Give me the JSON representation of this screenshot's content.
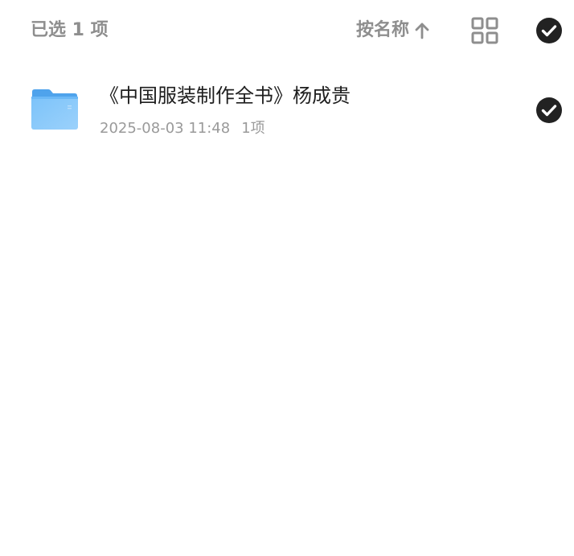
{
  "header": {
    "selection_label": "已选 1 项",
    "sort_label": "按名称",
    "sort_icon": "arrow-up-icon",
    "view_toggle_icon": "grid-view-icon",
    "select_all_icon": "check-circle-icon"
  },
  "files": [
    {
      "icon": "folder-icon",
      "name": "《中国服装制作全书》杨成贵",
      "modified": "2025-08-03 11:48",
      "item_count": "1项",
      "selected": true
    }
  ],
  "colors": {
    "muted_text": "#8e8e8e",
    "primary_text": "#1e1e1e",
    "meta_text": "#9a9a9a",
    "check_fill": "#222222",
    "folder_blue": "#5fb2f5"
  }
}
